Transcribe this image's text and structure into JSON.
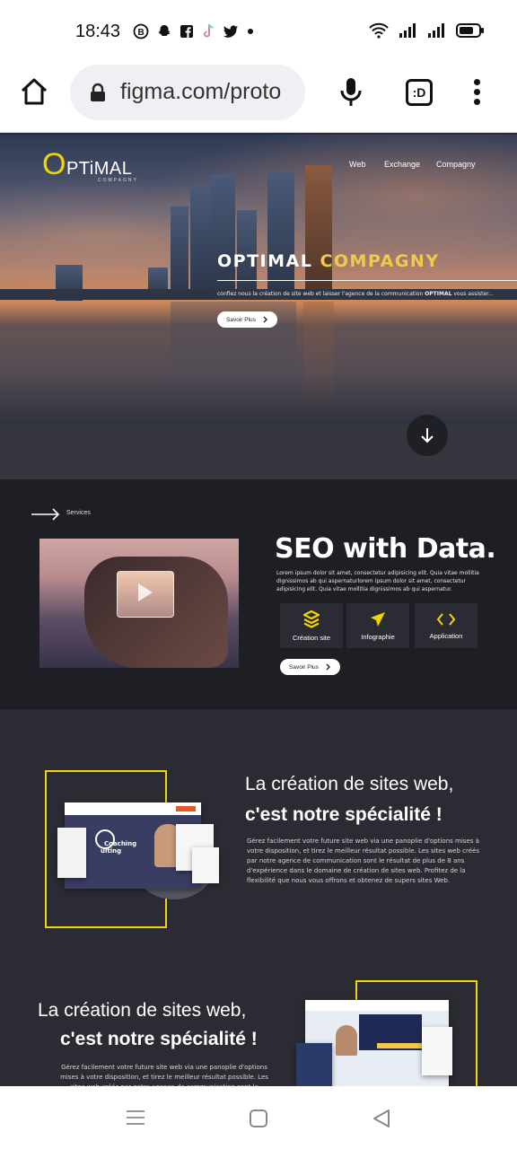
{
  "status_bar": {
    "time": "18:43",
    "app_icons": [
      "b-circle-icon",
      "snapchat-icon",
      "facebook-icon",
      "tiktok-icon",
      "twitter-icon",
      "dot-icon"
    ],
    "system_icons": [
      "wifi-icon",
      "signal-icon",
      "signal-icon",
      "battery-icon"
    ]
  },
  "browser": {
    "url": "figma.com/proto",
    "tabs_label": ":D"
  },
  "hero": {
    "logo_big": "O",
    "logo_rest": "PTiMAL",
    "logo_tagline": "COMPAGNY",
    "nav": [
      "Web",
      "Exchange",
      "Compagny"
    ],
    "title_white": "OPTIMAL",
    "title_yellow": "COMPAGNY",
    "subtitle_pre": "confiez nous la création de site web et laisser l'agence de la communication ",
    "subtitle_bold": "OPTIMAL",
    "subtitle_post": " vous assister...",
    "cta": "Savoir Plus"
  },
  "services": {
    "label": "Services",
    "title": "SEO with Data.",
    "description": "Lorem ipsum dolor sit amet, consectetur adipisicing elit. Quia vitae mollitia dignissimos ab qui aspernaturlorem ipsum dolor sit amet, consectetur adipisicing elit. Quia vitae mollitia dignissimos ab qui aspernatur.",
    "cards": [
      {
        "label": "Création site",
        "icon": "layers-icon"
      },
      {
        "label": "Infographie",
        "icon": "cursor-arrow-icon"
      },
      {
        "label": "Application",
        "icon": "code-brackets-icon"
      }
    ],
    "cta": "Savoir Plus"
  },
  "creation_1": {
    "heading_line1": "La création de sites web,",
    "heading_line2": "c'est notre spécialité !",
    "paragraph": "Gérez facilement votre future site web via une panoplie d'options mises à votre disposition, et tirez le meilleur résultat possible. Les sites web créés par notre agence de communication sont le résultat de plus de 8 ans d'expérience dans le domaine de création de sites web. Profitez de la flexibilité que nous vous offrons et obtenez de supers sites Web.",
    "mockup_text_1": "Coaching",
    "mockup_text_2": "ulting"
  },
  "creation_2": {
    "heading_line1": "La création de sites web,",
    "heading_line2": "c'est notre spécialité !",
    "paragraph": "Gérez facilement votre future site web via une panoplie d'options mises à votre disposition, et tirez le meilleur résultat possible. Les sites web créés par notre agence de communication sont le"
  },
  "colors": {
    "accent_yellow": "#f2d500",
    "dark_bg": "#2b2c33",
    "darker_bg": "#1e1f25"
  }
}
